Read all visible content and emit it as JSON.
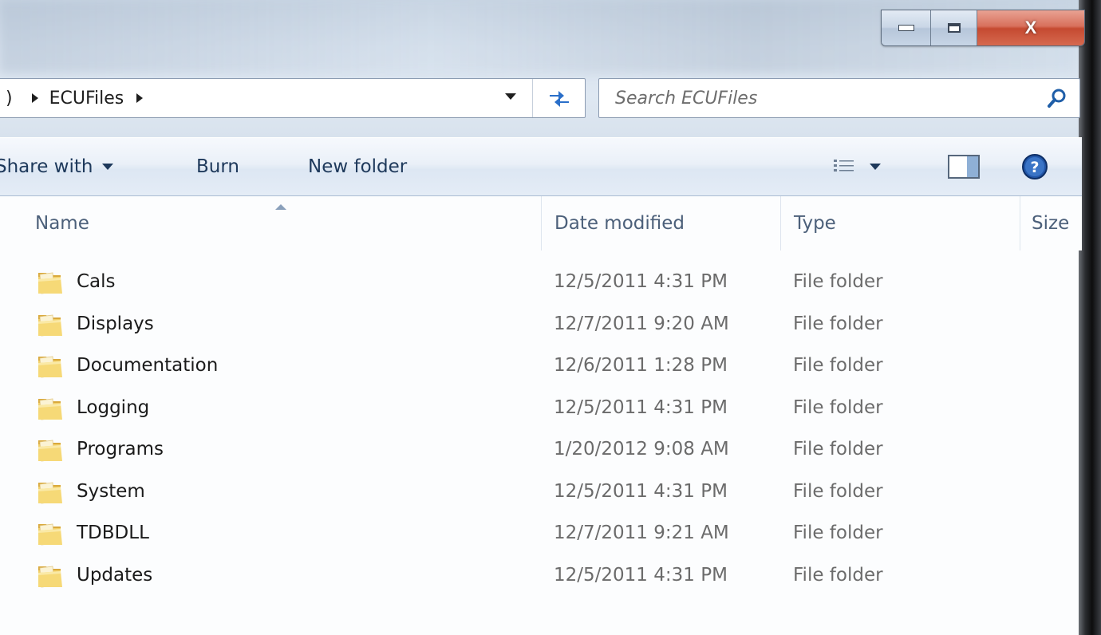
{
  "window": {
    "minimize_icon": "minimize-icon",
    "maximize_icon": "maximize-icon",
    "close_label": "X"
  },
  "address": {
    "prefix_fragment": ")",
    "current_folder": "ECUFiles"
  },
  "search": {
    "placeholder": "Search ECUFiles",
    "icon": "search-icon"
  },
  "toolbar": {
    "share_label": "Share with",
    "burn_label": "Burn",
    "new_folder_label": "New folder",
    "views_icon": "details-view-icon",
    "preview_icon": "preview-pane-icon",
    "help_icon": "help-icon"
  },
  "columns": {
    "name": "Name",
    "date": "Date modified",
    "type": "Type",
    "size": "Size"
  },
  "files": [
    {
      "name": "Cals",
      "date": "12/5/2011 4:31 PM",
      "type": "File folder"
    },
    {
      "name": "Displays",
      "date": "12/7/2011 9:20 AM",
      "type": "File folder"
    },
    {
      "name": "Documentation",
      "date": "12/6/2011 1:28 PM",
      "type": "File folder"
    },
    {
      "name": "Logging",
      "date": "12/5/2011 4:31 PM",
      "type": "File folder"
    },
    {
      "name": "Programs",
      "date": "1/20/2012 9:08 AM",
      "type": "File folder"
    },
    {
      "name": "System",
      "date": "12/5/2011 4:31 PM",
      "type": "File folder"
    },
    {
      "name": "TDBDLL",
      "date": "12/7/2011 9:21 AM",
      "type": "File folder"
    },
    {
      "name": "Updates",
      "date": "12/5/2011 4:31 PM",
      "type": "File folder"
    }
  ],
  "colors": {
    "command_text": "#1e395b",
    "header_text": "#4c607a",
    "detail_text": "#6b6b6b",
    "close_button": "#c54a31"
  }
}
